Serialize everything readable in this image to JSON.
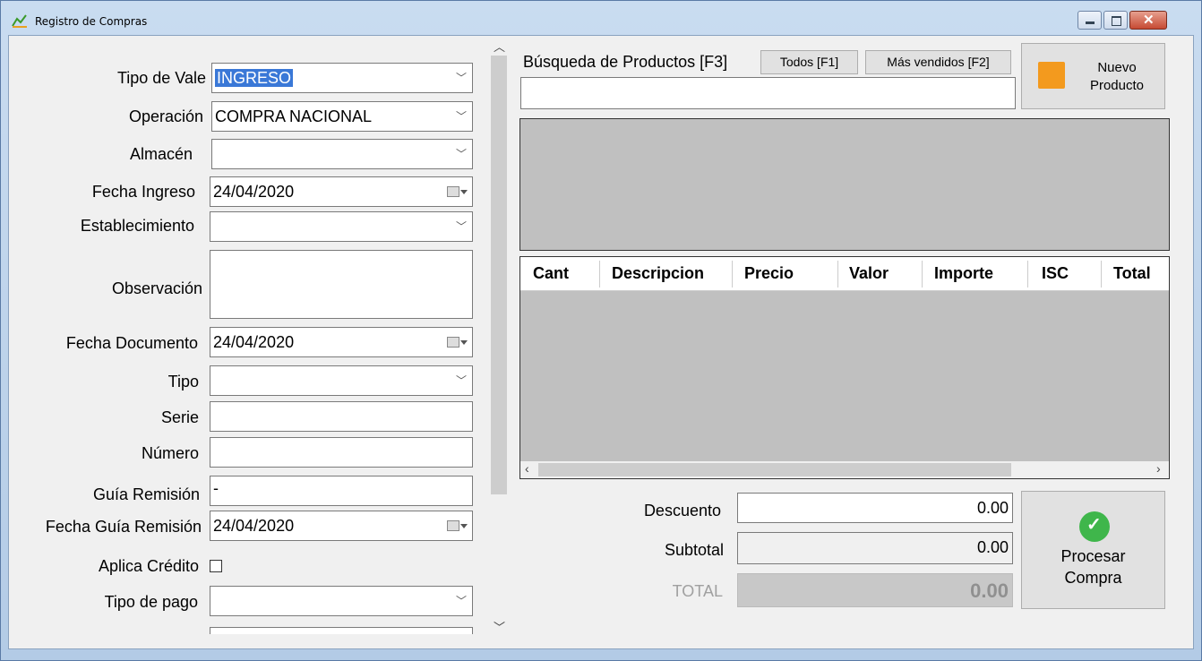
{
  "window": {
    "title": "Registro de Compras"
  },
  "form": {
    "tipo_vale": {
      "label": "Tipo de Vale",
      "value": "INGRESO"
    },
    "operacion": {
      "label": "Operación",
      "value": "COMPRA NACIONAL"
    },
    "almacen": {
      "label": "Almacén",
      "value": ""
    },
    "fecha_ingreso": {
      "label": "Fecha Ingreso",
      "value": "24/04/2020"
    },
    "establecimiento": {
      "label": "Establecimiento",
      "value": ""
    },
    "observacion": {
      "label": "Observación",
      "value": ""
    },
    "fecha_documento": {
      "label": "Fecha Documento",
      "value": "24/04/2020"
    },
    "tipo": {
      "label": "Tipo",
      "value": ""
    },
    "serie": {
      "label": "Serie",
      "value": ""
    },
    "numero": {
      "label": "Número",
      "value": ""
    },
    "guia_remision": {
      "label": "Guía Remisión",
      "value": "-"
    },
    "fecha_guia": {
      "label": "Fecha Guía Remisión",
      "value": "24/04/2020"
    },
    "aplica_credito": {
      "label": "Aplica Crédito",
      "checked": false
    },
    "tipo_pago": {
      "label": "Tipo de pago",
      "value": ""
    }
  },
  "search": {
    "label": "Búsqueda de Productos [F3]",
    "todos_label": "Todos [F1]",
    "mas_vendidos_label": "Más vendidos [F2]",
    "value": ""
  },
  "nuevo_producto": {
    "line1": "Nuevo",
    "line2": "Producto"
  },
  "grid": {
    "columns": [
      "Cant",
      "Descripcion",
      "Precio",
      "Valor",
      "Importe",
      "ISC",
      "Total"
    ],
    "rows": []
  },
  "totals": {
    "descuento": {
      "label": "Descuento",
      "value": "0.00"
    },
    "subtotal": {
      "label": "Subtotal",
      "value": "0.00"
    },
    "total": {
      "label": "TOTAL",
      "value": "0.00"
    }
  },
  "procesar": {
    "line1": "Procesar",
    "line2": "Compra"
  },
  "colors": {
    "selection": "#3a78d7",
    "panel_gray": "#c0c0c0",
    "success_green": "#3fb64b",
    "orange_box": "#f39a1e"
  }
}
